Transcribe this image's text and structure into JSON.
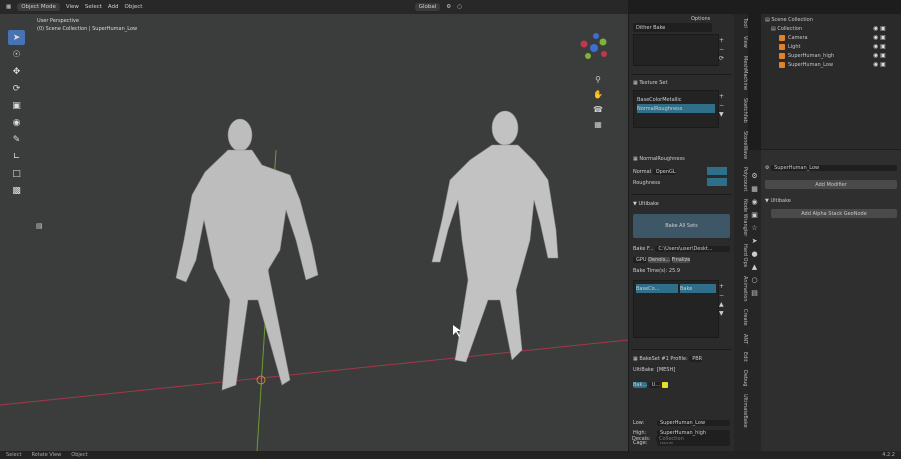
{
  "header": {
    "mode": "Object Mode",
    "menus": [
      "View",
      "Select",
      "Add",
      "Object"
    ],
    "transform_orientation": "Global",
    "options_label": "Options"
  },
  "viewport": {
    "perspective": "User Perspective",
    "collection_path": "(0) Scene Collection | SuperHuman_Low"
  },
  "panel": {
    "top_field": "Dither Bake",
    "texture_set_label": "Texture Set",
    "texture_items": [
      "BaseColorMetallic",
      "NormalRoughness"
    ],
    "selected_set": "NormalRoughness",
    "normal_label": "Normal",
    "normal_format": "OpenGL",
    "roughness_label": "Roughness",
    "ultibake_label": "Ultibake",
    "bake_all_sets": "Bake All Sets",
    "bake_folder_label": "Bake F...",
    "bake_folder_value": "C:\\Users\\user\\Deskt...",
    "device": "GPU",
    "denoise": "Denois...",
    "finalize": "Finalize",
    "bake_time": "Bake Time(s): 25.9",
    "bake_tab_1": "BaseCo...",
    "bake_tab_2": "Bake",
    "bakeset_label": "BakeSet #1",
    "profile_label": "Profile:",
    "profile_value": "PBR",
    "ultibake_obj": "UltiBake",
    "ultibake_obj_extra": "[MESH]",
    "bake_chip": "Bak...",
    "u_chip": "U...",
    "low_label": "Low:",
    "low_value": "SuperHuman_Low",
    "high_label": "High:",
    "high_value": "SuperHuman_high",
    "cage_label": "Cage:",
    "cage_value": "None",
    "decals_label": "Decals:",
    "decals_value": "Collection"
  },
  "tabs": [
    "Tool",
    "View",
    "MeshMachine",
    "Sketchfab",
    "StoneWave",
    "Polycount",
    "Node Wrangler",
    "Hard Ops",
    "Animation",
    "Create",
    "ANT",
    "Edit",
    "Debug",
    "UltimateBake"
  ],
  "outliner": {
    "root": "Scene Collection",
    "collection": "Collection",
    "items": [
      {
        "name": "Camera",
        "color": "#e0822d"
      },
      {
        "name": "Light",
        "color": "#e0822d"
      },
      {
        "name": "SuperHuman_high",
        "color": "#e0822d"
      },
      {
        "name": "SuperHuman_Low",
        "color": "#e0822d"
      }
    ]
  },
  "properties": {
    "object_name": "SuperHuman_Low",
    "add_modifier": "Add Modifier",
    "ultibake_section": "Ultibake",
    "add_alpha": "Add Alpha Stack GeoNode"
  },
  "status": {
    "select": "Select",
    "rotate": "Rotate View",
    "object": "Object",
    "version": "4.2.2"
  },
  "colors": {
    "accent": "#4772b3",
    "selection": "#2f6f8a",
    "x_axis": "#b0384a",
    "y_axis": "#7fb23a"
  }
}
